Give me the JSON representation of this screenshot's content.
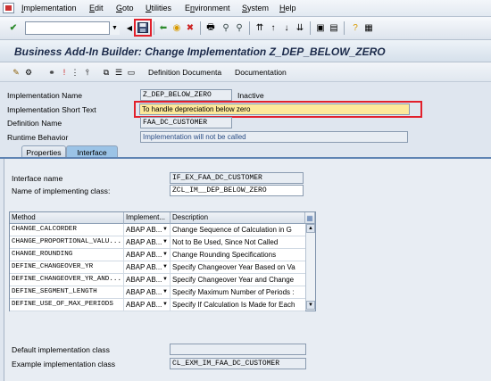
{
  "menu": {
    "items": [
      "Implementation",
      "Edit",
      "Goto",
      "Utilities",
      "Environment",
      "System",
      "Help"
    ],
    "underline": [
      "I",
      "E",
      "G",
      "U",
      "n",
      "S",
      "H"
    ]
  },
  "command_field": {
    "value": ""
  },
  "page_title": "Business Add-In Builder: Change Implementation Z_DEP_BELOW_ZERO",
  "app_toolbar": {
    "definition_doc": "Definition Documenta",
    "documentation": "Documentation"
  },
  "header": {
    "impl_name_label": "Implementation Name",
    "impl_name_value": "Z_DEP_BELOW_ZERO",
    "impl_status": "Inactive",
    "short_text_label": "Implementation Short Text",
    "short_text_value": "To handle depreciation below zero",
    "def_name_label": "Definition Name",
    "def_name_value": "FAA_DC_CUSTOMER",
    "runtime_label": "Runtime Behavior",
    "runtime_value": "Implementation will not be called"
  },
  "tabs": [
    "Properties",
    "Interface"
  ],
  "interface": {
    "if_name_label": "Interface name",
    "if_name_value": "IF_EX_FAA_DC_CUSTOMER",
    "class_label": "Name of implementing class:",
    "class_value": "ZCL_IM__DEP_BELOW_ZERO"
  },
  "table": {
    "headers": [
      "Method",
      "Implement...",
      "Description"
    ],
    "rows": [
      {
        "method": "CHANGE_CALCORDER",
        "impl": "ABAP AB...",
        "desc": "Change Sequence of Calculation in G"
      },
      {
        "method": "CHANGE_PROPORTIONAL_VALU...",
        "impl": "ABAP AB...",
        "desc": "Not to Be Used, Since Not Called"
      },
      {
        "method": "CHANGE_ROUNDING",
        "impl": "ABAP AB...",
        "desc": "Change Rounding Specifications"
      },
      {
        "method": "DEFINE_CHANGEOVER_YR",
        "impl": "ABAP AB...",
        "desc": "Specify Changeover Year Based on Va"
      },
      {
        "method": "DEFINE_CHANGEOVER_YR_AND...",
        "impl": "ABAP AB...",
        "desc": "Specify Changeover Year and Change"
      },
      {
        "method": "DEFINE_SEGMENT_LENGTH",
        "impl": "ABAP AB...",
        "desc": "Specify Maximum Number of Periods :"
      },
      {
        "method": "DEFINE_USE_OF_MAX_PERIODS",
        "impl": "ABAP AB...",
        "desc": "Specify If Calculation Is Made for Each"
      }
    ]
  },
  "footer": {
    "default_class_label": "Default implementation class",
    "default_class_value": "",
    "example_class_label": "Example implementation class",
    "example_class_value": "CL_EXM_IM_FAA_DC_CUSTOMER"
  },
  "colors": {
    "highlight_red": "#e2202b",
    "tab_active": "#9bc3e6",
    "yellow_field": "#fde99a"
  }
}
